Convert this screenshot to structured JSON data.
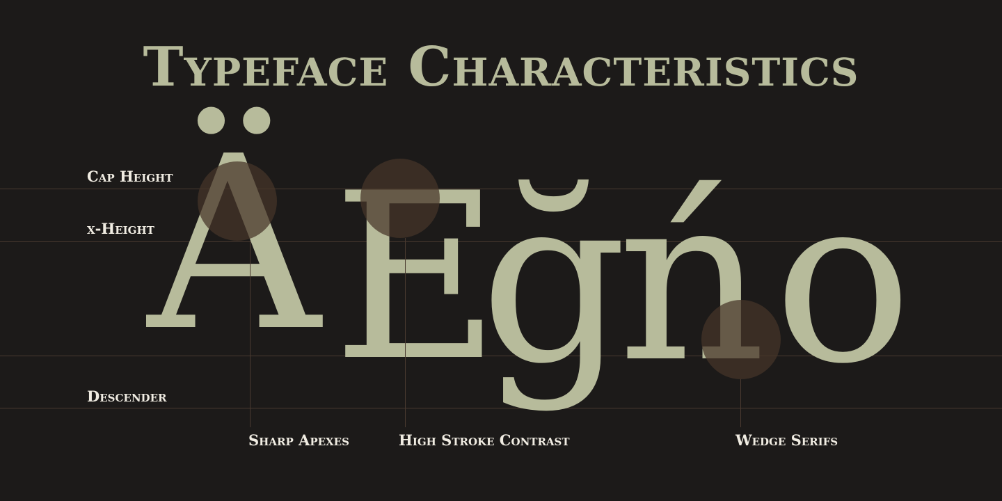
{
  "title": "Typeface Characteristics",
  "specimen": {
    "letters": [
      "Ä",
      "E",
      "ğ",
      "ń",
      "o"
    ]
  },
  "metrics": {
    "cap_height": "Cap Height",
    "x_height": "x-Height",
    "descender": "Descender"
  },
  "callouts": {
    "sharp_apexes": "Sharp Apexes",
    "high_stroke_contrast": "High Stroke Contrast",
    "wedge_serifs": "Wedge Serifs"
  },
  "colors": {
    "background": "#1c1a19",
    "glyph": "#b7bb9b",
    "label": "#f0ece2",
    "guide": "#4a3a30",
    "highlight": "#463428"
  }
}
